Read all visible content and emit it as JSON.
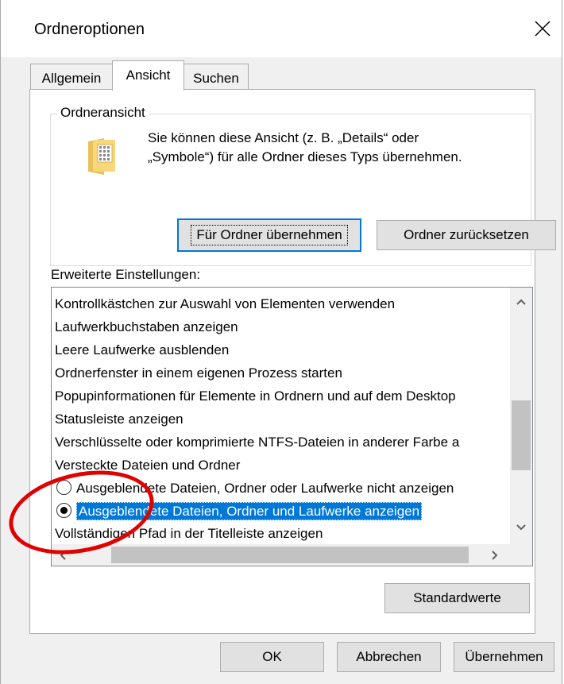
{
  "window": {
    "title": "Ordneroptionen"
  },
  "tabs": [
    {
      "label": "Allgemein",
      "active": false
    },
    {
      "label": "Ansicht",
      "active": true
    },
    {
      "label": "Suchen",
      "active": false
    }
  ],
  "folder_view": {
    "group_label": "Ordneransicht",
    "icon": "folder-details-icon",
    "info_line1": "Sie können diese Ansicht (z. B. „Details“ oder",
    "info_line2": "„Symbole“) für alle Ordner dieses Typs übernehmen.",
    "apply_button": "Für Ordner übernehmen",
    "reset_button": "Ordner zurücksetzen"
  },
  "advanced": {
    "label": "Erweiterte Einstellungen:",
    "items": [
      {
        "text": "Kontrollkästchen zur Auswahl von Elementen verwenden",
        "type": "option"
      },
      {
        "text": "Laufwerkbuchstaben anzeigen",
        "type": "option"
      },
      {
        "text": "Leere Laufwerke ausblenden",
        "type": "option"
      },
      {
        "text": "Ordnerfenster in einem eigenen Prozess starten",
        "type": "option"
      },
      {
        "text": "Popupinformationen für Elemente in Ordnern und auf dem Desktop",
        "type": "option"
      },
      {
        "text": "Statusleiste anzeigen",
        "type": "option"
      },
      {
        "text": "Verschlüsselte oder komprimierte NTFS-Dateien in anderer Farbe a",
        "type": "option"
      },
      {
        "text": "Versteckte Dateien und Ordner",
        "type": "group"
      },
      {
        "text": "Ausgeblendete Dateien, Ordner oder Laufwerke nicht anzeigen",
        "type": "radio",
        "checked": false
      },
      {
        "text": "Ausgeblendete Dateien, Ordner und Laufwerke anzeigen",
        "type": "radio",
        "checked": true,
        "selected": true
      },
      {
        "text": "Vollständigen Pfad in der Titelleiste anzeigen",
        "type": "option"
      }
    ],
    "defaults_button": "Standardwerte"
  },
  "footer": {
    "ok": "OK",
    "cancel": "Abbrechen",
    "apply": "Übernehmen"
  },
  "colors": {
    "selection": "#0078d7",
    "annotation": "#e00000"
  }
}
